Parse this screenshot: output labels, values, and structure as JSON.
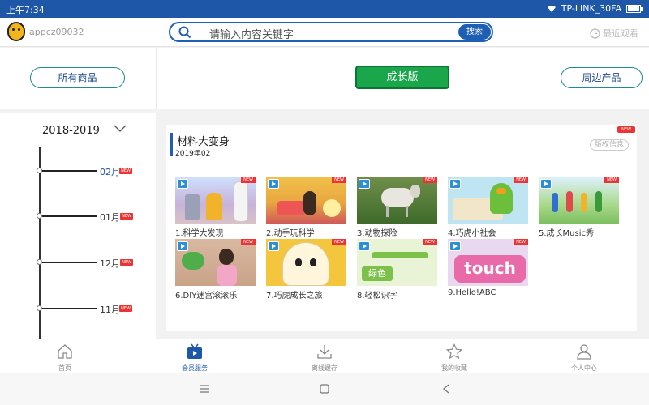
{
  "status": {
    "time": "上午7:34",
    "network": "TP-LINK_30FA"
  },
  "topbar": {
    "account": "appcz09032",
    "search_placeholder": "请输入内容关键字",
    "search_button": "搜索",
    "recent": "最近观看"
  },
  "tabs": {
    "all_products": "所有商品",
    "growth": "成长版",
    "merch": "周边产品"
  },
  "sidebar": {
    "year": "2018-2019",
    "months": [
      {
        "label": "02月",
        "badge": "NEW",
        "selected": true
      },
      {
        "label": "01月",
        "badge": "NEW",
        "selected": false
      },
      {
        "label": "12月",
        "badge": "NEW",
        "selected": false
      },
      {
        "label": "11月",
        "badge": "NEW",
        "selected": false
      }
    ]
  },
  "content": {
    "title": "材料大变身",
    "date": "2019年02",
    "copyright": "版权信息",
    "badge": "NEW",
    "items": [
      {
        "label": "1.科学大发现",
        "badge": "NEW"
      },
      {
        "label": "2.动手玩科学",
        "badge": "NEW"
      },
      {
        "label": "3.动物探险",
        "badge": "NEW"
      },
      {
        "label": "4.巧虎小社会",
        "badge": "NEW"
      },
      {
        "label": "5.成长Music秀",
        "badge": "NEW"
      },
      {
        "label": "6.DIY迷宫滚滚乐",
        "badge": "NEW"
      },
      {
        "label": "7.巧虎成长之旅",
        "badge": "NEW"
      },
      {
        "label": "8.轻松识字",
        "badge": "NEW",
        "thumb_text": "绿色"
      },
      {
        "label": "9.Hello!ABC",
        "badge": "NEW",
        "thumb_text": "touch"
      }
    ]
  },
  "bottom_nav": [
    {
      "label": "首页",
      "icon": "home-icon"
    },
    {
      "label": "会员服务",
      "icon": "tv-icon",
      "active": true
    },
    {
      "label": "离线缓存",
      "icon": "download-icon"
    },
    {
      "label": "我的收藏",
      "icon": "star-icon"
    },
    {
      "label": "个人中心",
      "icon": "person-icon"
    }
  ],
  "colors": {
    "status_bar": "#1e56a8",
    "accent_blue": "#1f5fb3",
    "active_green": "#1aa64a",
    "badge_red": "#e33333"
  }
}
